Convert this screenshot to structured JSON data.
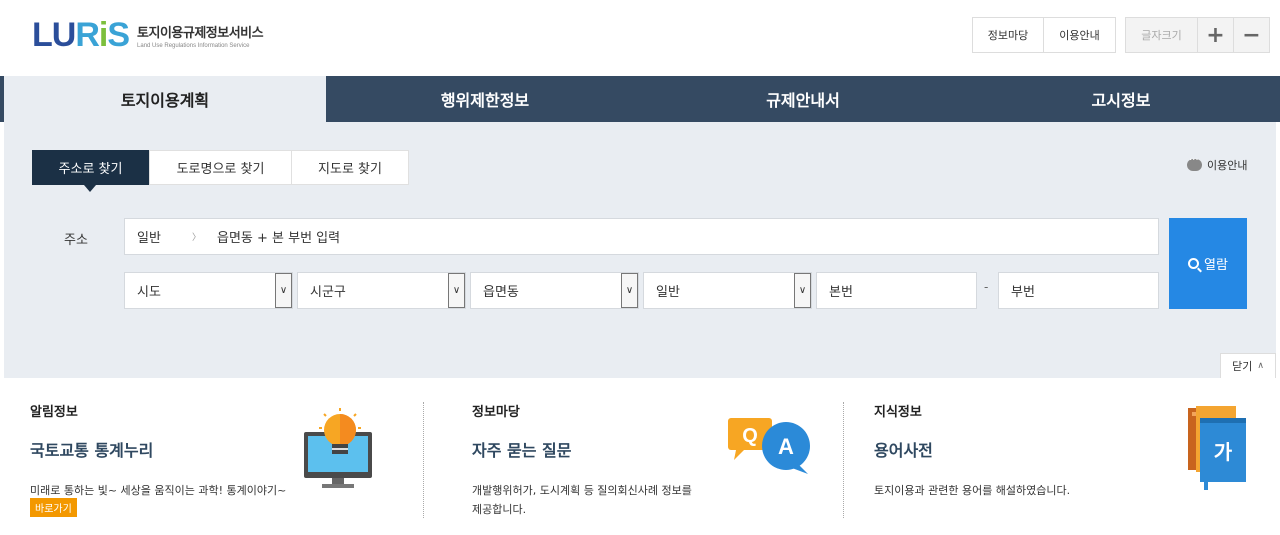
{
  "header": {
    "logo_text": "LURIS",
    "logo_title": "토지이용규제정보서비스",
    "logo_subtitle": "Land Use Regulations Information Service",
    "top_links": [
      "정보마당",
      "이용안내"
    ],
    "font_size_label": "글자크기",
    "font_increase": "+",
    "font_decrease": "−"
  },
  "nav": {
    "items": [
      {
        "label": "토지이용계획",
        "active": true
      },
      {
        "label": "행위제한정보",
        "active": false
      },
      {
        "label": "규제안내서",
        "active": false
      },
      {
        "label": "고시정보",
        "active": false
      }
    ]
  },
  "search": {
    "tabs": [
      {
        "label": "주소로 찾기",
        "active": true
      },
      {
        "label": "도로명으로 찾기",
        "active": false
      },
      {
        "label": "지도로 찾기",
        "active": false
      }
    ],
    "help_label": "이용안내",
    "address_label": "주소",
    "address_type": "일반",
    "address_value": "읍면동 + 본 부번 입력",
    "selects": [
      "시도",
      "시군구",
      "읍면동",
      "일반"
    ],
    "main_number_placeholder": "본번",
    "sub_number_placeholder": "부번",
    "separator": "-",
    "search_button": "열람",
    "close_button": "닫기"
  },
  "info": {
    "columns": [
      {
        "category": "알림정보",
        "title": "국토교통 통계누리",
        "description": "미래로 통하는 빛~ 세상을 움직이는 과학! 통계이야기~",
        "button": "바로가기"
      },
      {
        "category": "정보마당",
        "title": "자주 묻는 질문",
        "description_lines": [
          "개발행위허가, 도시계획 등 질의회신사례 정보를",
          "제공합니다."
        ]
      },
      {
        "category": "지식정보",
        "title": "용어사전",
        "description": "토지이용과 관련한 용어를 해설하였습니다.",
        "book_char": "가"
      }
    ]
  },
  "colors": {
    "nav_bg": "#354a62",
    "panel_bg": "#e9edf2",
    "active_tab": "#1b3045",
    "search_button": "#2588e4",
    "shortcut_button": "#f39800"
  }
}
